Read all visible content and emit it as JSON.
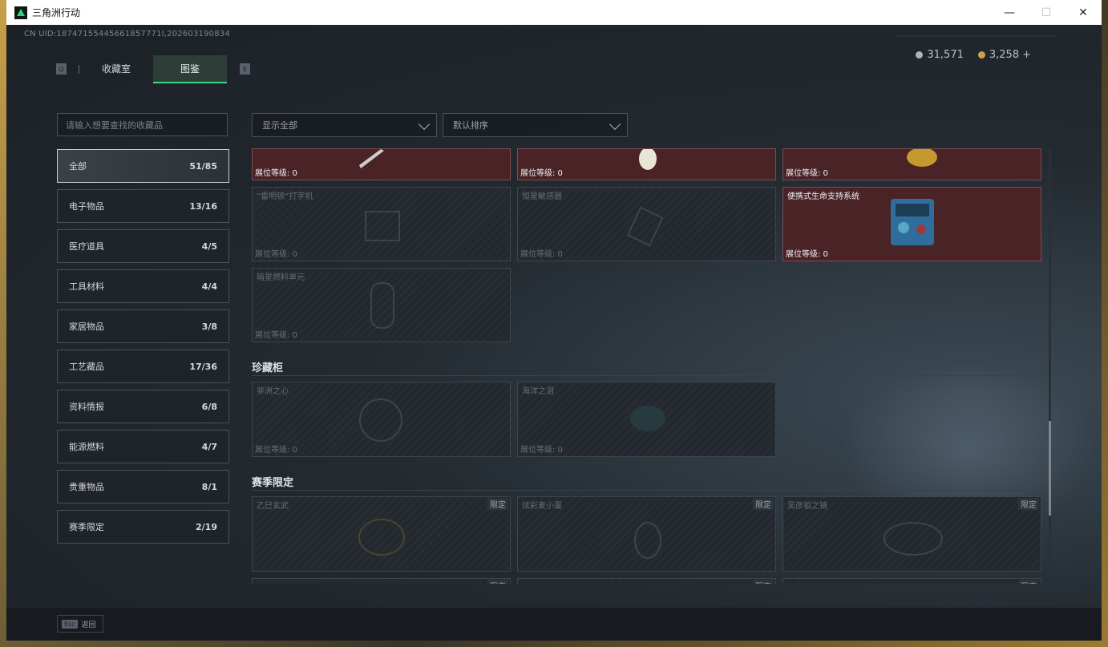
{
  "window": {
    "title": "三角洲行动"
  },
  "header": {
    "uid": "CN UID:18747155445661857771I,202603190834",
    "currency": {
      "silver": "31,571",
      "gold": "3,258",
      "plus": "+"
    }
  },
  "tabs": {
    "key_left": "Q",
    "key_right": "E",
    "items": [
      "收藏室",
      "图鉴"
    ]
  },
  "search": {
    "placeholder": "请输入想要查找的收藏品"
  },
  "categories": [
    {
      "label": "全部",
      "count": "51/85"
    },
    {
      "label": "电子物品",
      "count": "13/16"
    },
    {
      "label": "医疗道具",
      "count": "4/5"
    },
    {
      "label": "工具材料",
      "count": "4/4"
    },
    {
      "label": "家居物品",
      "count": "3/8"
    },
    {
      "label": "工艺藏品",
      "count": "17/36"
    },
    {
      "label": "资料情报",
      "count": "6/8"
    },
    {
      "label": "能源燃料",
      "count": "4/7"
    },
    {
      "label": "贵重物品",
      "count": "8/1"
    },
    {
      "label": "赛季限定",
      "count": "2/19"
    }
  ],
  "filters": {
    "display": "显示全部",
    "sort": "默认排序"
  },
  "level_label": "展位等级: 0",
  "cards_top": [
    {
      "name": "",
      "owned": true
    },
    {
      "name": "",
      "owned": true
    },
    {
      "name": "",
      "owned": true
    },
    {
      "name": "“雷明顿”打字机",
      "owned": false
    },
    {
      "name": "恒星敏感器",
      "owned": false
    },
    {
      "name": "便携式生命支持系统",
      "owned": true
    },
    {
      "name": "暗星燃料单元",
      "owned": false
    }
  ],
  "sections": [
    {
      "title": "珍藏柜",
      "cards": [
        "非洲之心",
        "海洋之泪"
      ]
    },
    {
      "title": "赛季限定",
      "badge": "限定",
      "cards": [
        "乙巳玄武",
        "炫彩麦小蛋",
        "吴彦祖之镜"
      ]
    }
  ],
  "footer": {
    "esc_key": "Esc",
    "back_label": "返回"
  }
}
